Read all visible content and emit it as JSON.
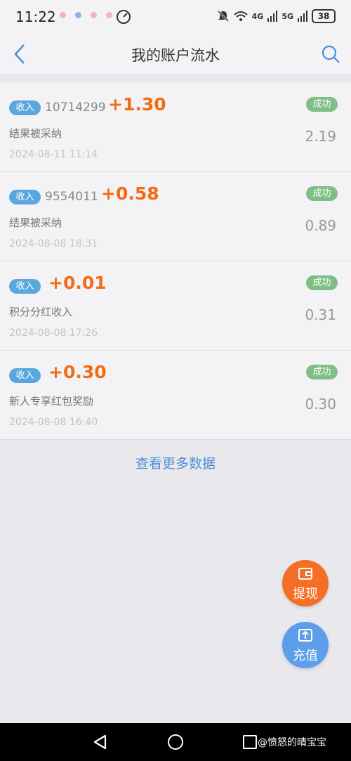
{
  "status_bar": {
    "time": "11:22",
    "network_1": "4G",
    "network_2": "5G",
    "battery": "38"
  },
  "header": {
    "title": "我的账户流水"
  },
  "records": [
    {
      "tag": "收入",
      "id": "10714299",
      "amount": "+1.30",
      "status": "成功",
      "description": "结果被采纳",
      "balance": "2.19",
      "datetime": "2024-08-11 11:14"
    },
    {
      "tag": "收入",
      "id": "9554011",
      "amount": "+0.58",
      "status": "成功",
      "description": "结果被采纳",
      "balance": "0.89",
      "datetime": "2024-08-08 18:31"
    },
    {
      "tag": "收入",
      "id": "",
      "amount": "+0.01",
      "status": "成功",
      "description": "积分分红收入",
      "balance": "0.31",
      "datetime": "2024-08-08 17:26"
    },
    {
      "tag": "收入",
      "id": "",
      "amount": "+0.30",
      "status": "成功",
      "description": "新人专享红包奖励",
      "balance": "0.30",
      "datetime": "2024-08-08 16:40"
    }
  ],
  "more_link": "查看更多数据",
  "fab": {
    "withdraw": "提现",
    "recharge": "充值"
  },
  "watermark": "@愤怒的晴宝宝",
  "colors": {
    "accent_orange": "#f26c16",
    "tag_blue": "#5aa7df",
    "success_green": "#7fbf86",
    "link_blue": "#4a8fd6"
  }
}
